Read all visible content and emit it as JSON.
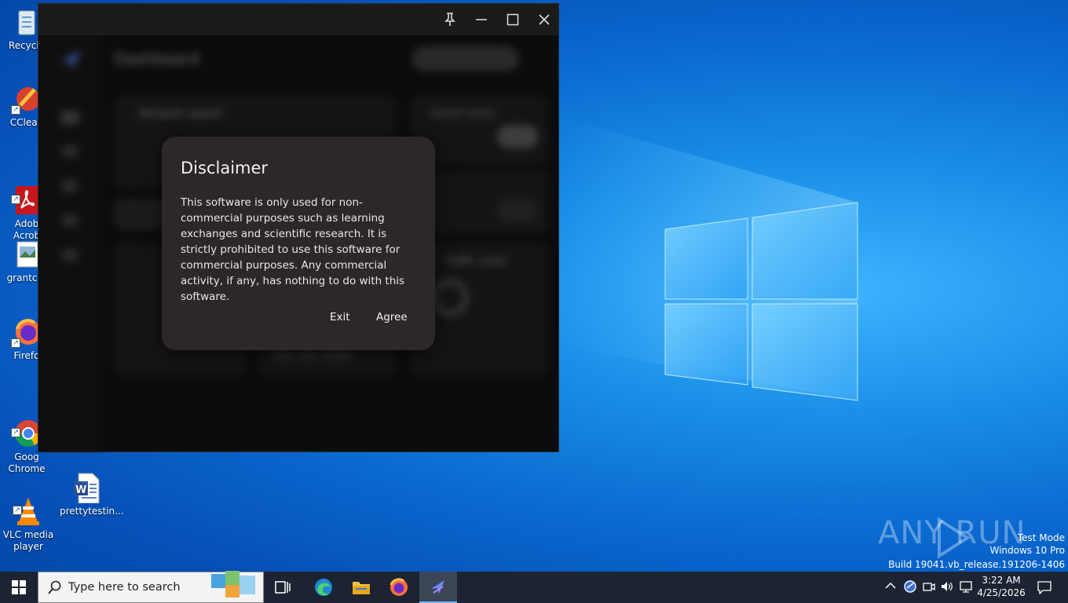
{
  "desktop": {
    "icons": [
      {
        "label": "Recycle",
        "icon": "recycle-bin-icon"
      },
      {
        "label": "CClean",
        "icon": "ccleaner-icon"
      },
      {
        "label": "Adob\nAcrob",
        "icon": "adobe-acrobat-icon"
      },
      {
        "label": "grantcat",
        "icon": "image-file-icon"
      },
      {
        "label": "Firefo",
        "icon": "firefox-icon"
      },
      {
        "label": "Goog\nChrome",
        "icon": "chrome-icon"
      },
      {
        "label": "VLC media\nplayer",
        "icon": "vlc-icon"
      },
      {
        "label": "prettytestin...",
        "icon": "word-document-icon"
      }
    ]
  },
  "app_window": {
    "background_blurred": {
      "page_title": "Dashboard",
      "card1_title": "Network speed",
      "card2_title": "System proxy",
      "card3_title": "Traffic usage",
      "footer_text": "Fast, safe, reliable"
    },
    "colors": {
      "background": "#0d0c0c",
      "dialog": "#2b2827"
    }
  },
  "dialog": {
    "title": "Disclaimer",
    "body": "This software is only used for non-commercial purposes such as learning exchanges and scientific research. It is strictly prohibited to use this software for commercial purposes. Any commercial activity, if any, has nothing to do with this software.",
    "exit_label": "Exit",
    "agree_label": "Agree"
  },
  "watermark": {
    "brand": "ANY RUN",
    "line1": "Test Mode",
    "line2": "Windows 10 Pro",
    "line3": "Build 19041.vb_release.191206-1406"
  },
  "taskbar": {
    "search_placeholder": "Type here to search",
    "pinned": [
      "task-view-icon",
      "edge-icon",
      "file-explorer-icon",
      "firefox-icon",
      "app-icon"
    ],
    "clock_time": "3:22 AM",
    "clock_date": "4/25/2026"
  }
}
